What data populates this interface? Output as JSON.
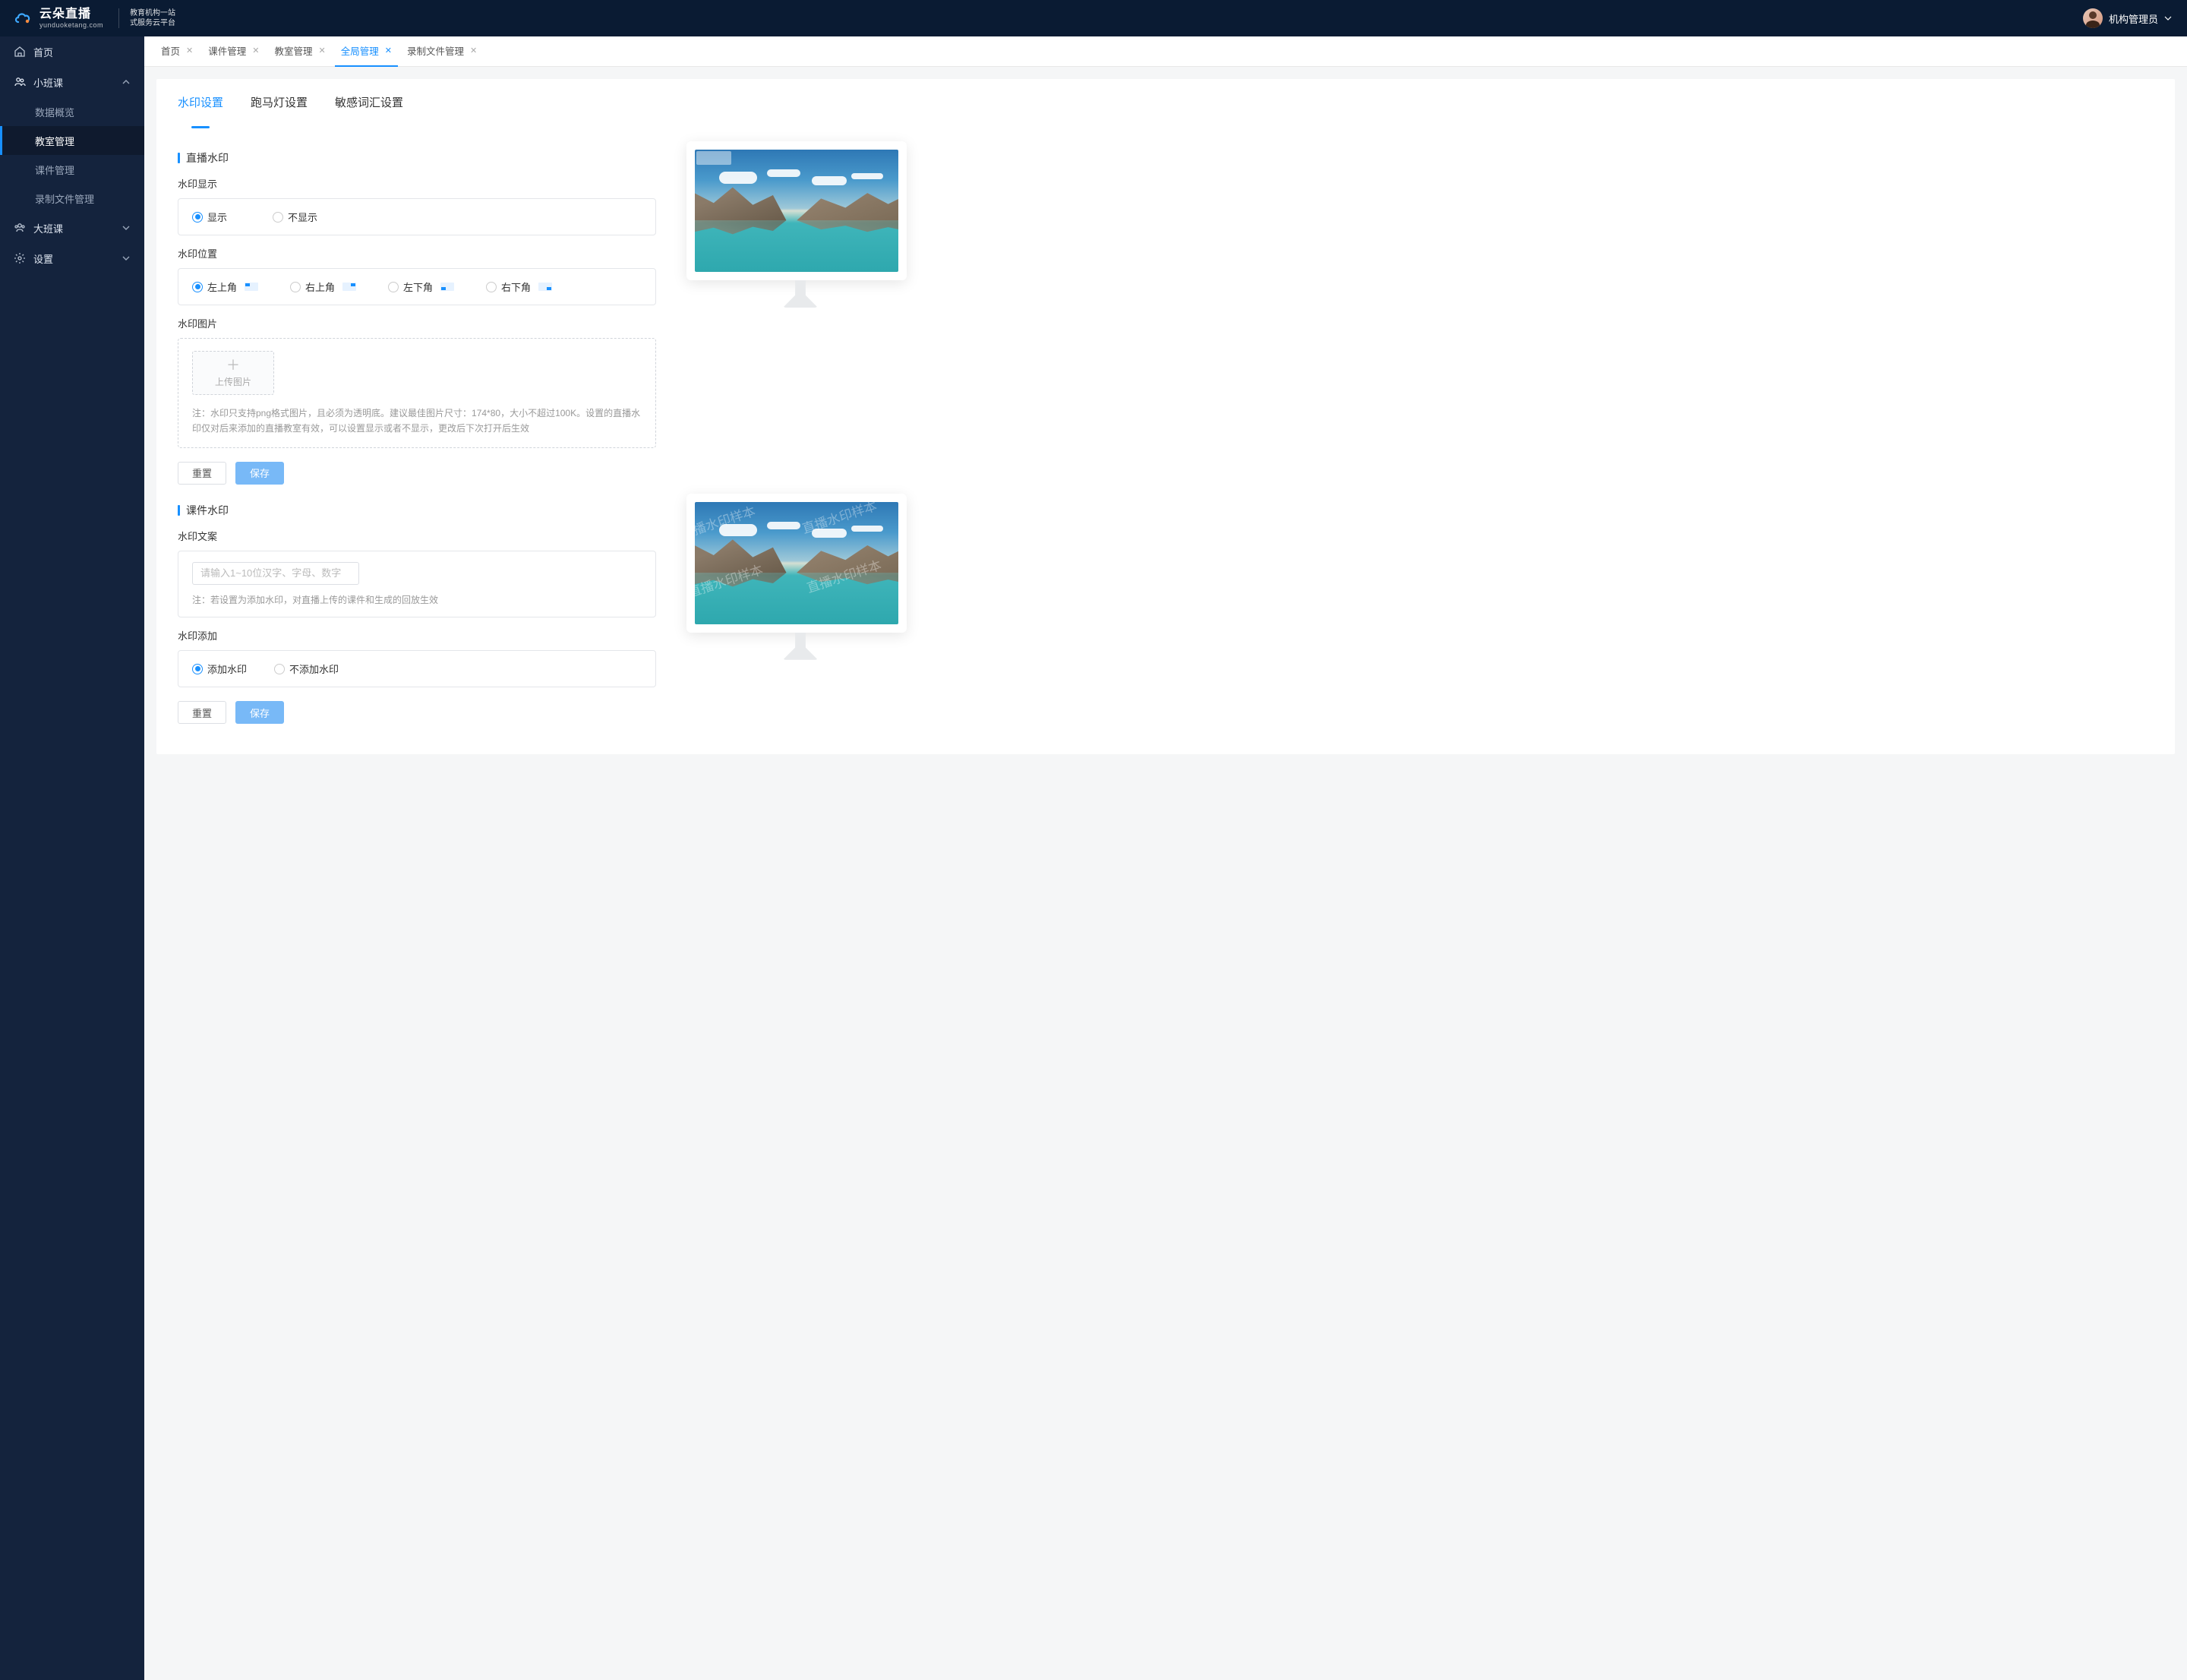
{
  "brand": {
    "name": "云朵直播",
    "domain": "yunduoketang.com",
    "tagline1": "教育机构一站",
    "tagline2": "式服务云平台"
  },
  "user": {
    "role": "机构管理员"
  },
  "sidebar": {
    "home": "首页",
    "small_class": "小班课",
    "small_items": {
      "overview": "数据概览",
      "classroom": "教室管理",
      "courseware": "课件管理",
      "recording": "录制文件管理"
    },
    "big_class": "大班课",
    "settings": "设置"
  },
  "tabs": {
    "home": "首页",
    "courseware": "课件管理",
    "classroom": "教室管理",
    "global": "全局管理",
    "recording": "录制文件管理"
  },
  "subtabs": {
    "watermark": "水印设置",
    "marquee": "跑马灯设置",
    "sensitive": "敏感词汇设置"
  },
  "live_wm": {
    "section": "直播水印",
    "display_label": "水印显示",
    "opt_show": "显示",
    "opt_hide": "不显示",
    "position_label": "水印位置",
    "pos_tl": "左上角",
    "pos_tr": "右上角",
    "pos_bl": "左下角",
    "pos_br": "右下角",
    "image_label": "水印图片",
    "upload_label": "上传图片",
    "hint": "注：水印只支持png格式图片，且必须为透明底。建议最佳图片尺寸：174*80，大小不超过100K。设置的直播水印仅对后来添加的直播教室有效，可以设置显示或者不显示，更改后下次打开后生效"
  },
  "course_wm": {
    "section": "课件水印",
    "text_label": "水印文案",
    "placeholder": "请输入1~10位汉字、字母、数字",
    "hint": "注：若设置为添加水印，对直播上传的课件和生成的回放生效",
    "add_label": "水印添加",
    "opt_add": "添加水印",
    "opt_noadd": "不添加水印"
  },
  "buttons": {
    "reset": "重置",
    "save": "保存"
  },
  "preview_texts": [
    "直播水印样本",
    "直播水印样本",
    "直播水印样本",
    "直播水印样本"
  ]
}
